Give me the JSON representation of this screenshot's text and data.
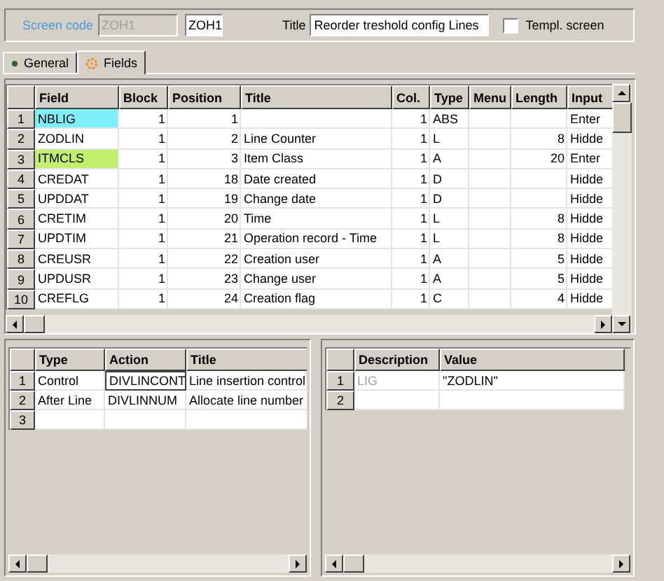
{
  "header": {
    "screen_code": {
      "label": "Screen code",
      "value": "ZOH1",
      "disabled": true
    },
    "code": {
      "value": "ZOH1"
    },
    "title": {
      "label": "Title",
      "value": "Reorder treshold config Lines"
    },
    "template_screen": {
      "label": "Templ. screen",
      "checked": false
    }
  },
  "tabs": [
    {
      "label": "General",
      "selected": false
    },
    {
      "label": "Fields",
      "selected": true
    }
  ],
  "fields_grid": {
    "columns": [
      "Field",
      "Block",
      "Position",
      "Title",
      "Col.",
      "Type",
      "Menu",
      "Length",
      "Input"
    ],
    "rows": [
      {
        "number": "1",
        "cells": [
          "NBLIG",
          "1",
          "1",
          "",
          "1",
          "ABS",
          "",
          "",
          "Enter"
        ],
        "color": "#7ff0fa"
      },
      {
        "number": "2",
        "cells": [
          "ZODLIN",
          "1",
          "2",
          "Line Counter",
          "1",
          "L",
          "",
          "8",
          "Hidde"
        ]
      },
      {
        "number": "3",
        "cells": [
          "ITMCLS",
          "1",
          "3",
          "Item Class",
          "1",
          "A",
          "",
          "20",
          "Enter"
        ],
        "color": "#c2f06e"
      },
      {
        "number": "4",
        "cells": [
          "CREDAT",
          "1",
          "18",
          "Date created",
          "1",
          "D",
          "",
          "",
          "Hidde"
        ]
      },
      {
        "number": "5",
        "cells": [
          "UPDDAT",
          "1",
          "19",
          "Change date",
          "1",
          "D",
          "",
          "",
          "Hidde"
        ]
      },
      {
        "number": "6",
        "cells": [
          "CRETIM",
          "1",
          "20",
          "Time",
          "1",
          "L",
          "",
          "8",
          "Hidde"
        ]
      },
      {
        "number": "7",
        "cells": [
          "UPDTIM",
          "1",
          "21",
          "Operation record - Time",
          "1",
          "L",
          "",
          "8",
          "Hidde"
        ]
      },
      {
        "number": "8",
        "cells": [
          "CREUSR",
          "1",
          "22",
          "Creation user",
          "1",
          "A",
          "",
          "5",
          "Hidde"
        ]
      },
      {
        "number": "9",
        "cells": [
          "UPDUSR",
          "1",
          "23",
          "Change user",
          "1",
          "A",
          "",
          "5",
          "Hidde"
        ]
      },
      {
        "number": "10",
        "cells": [
          "CREFLG",
          "1",
          "24",
          "Creation flag",
          "1",
          "C",
          "",
          "4",
          "Hidde"
        ]
      }
    ]
  },
  "actions_grid": {
    "columns": [
      "Type",
      "Action",
      "Title"
    ],
    "rows": [
      {
        "number": "1",
        "cells": [
          "Control",
          "DIVLINCONT",
          "Line insertion control"
        ],
        "selected": true
      },
      {
        "number": "2",
        "cells": [
          "After Line",
          "DIVLINNUM",
          "Allocate line number"
        ],
        "selected": false
      },
      {
        "number": "3",
        "selected": false
      }
    ]
  },
  "parameters_grid": {
    "columns": [
      "Description",
      "Value"
    ],
    "rows": [
      {
        "number": "1",
        "cells": [
          "LIG",
          "\"ZODLIN\""
        ],
        "disabled": true
      },
      {
        "number": "2"
      }
    ]
  }
}
